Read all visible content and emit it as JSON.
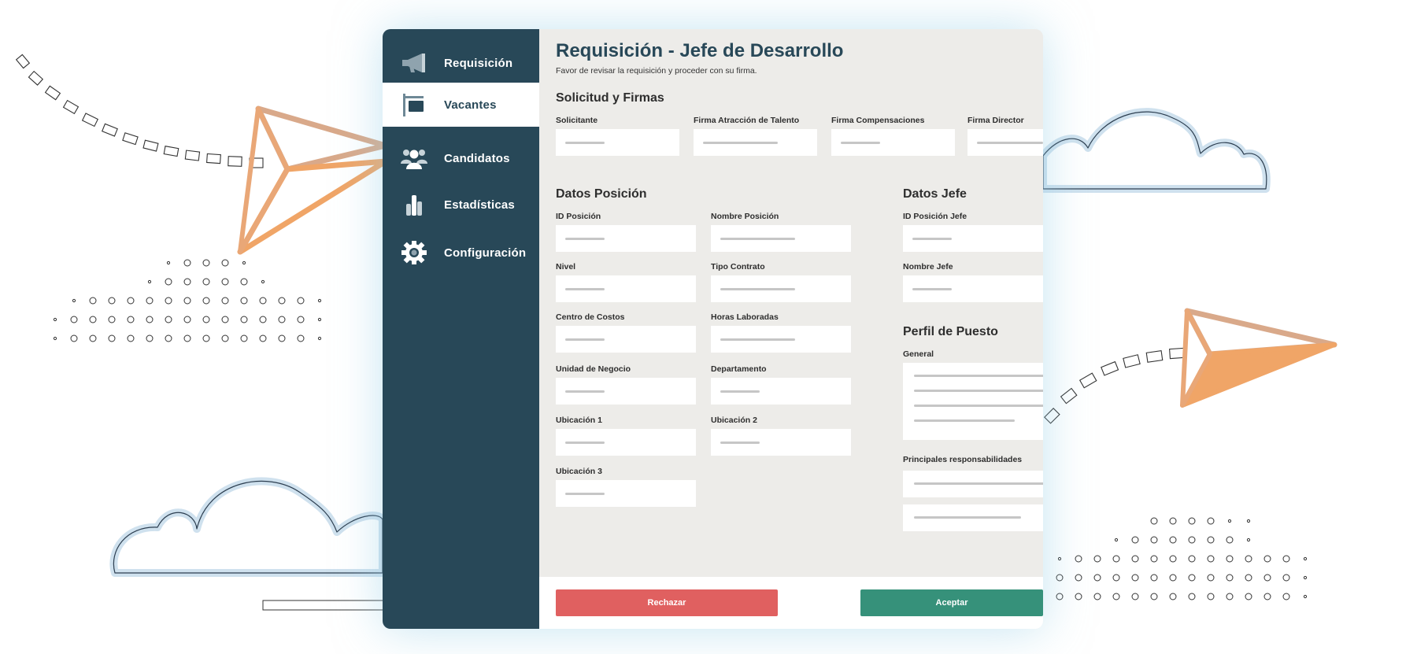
{
  "colors": {
    "sidebar": "#284858",
    "content_bg": "#edece9",
    "title": "#284858",
    "reject": "#e06060",
    "accept": "#36917a",
    "plane_orange": "#f0a567",
    "cloud_outline": "#cfe1ee"
  },
  "sidebar": {
    "items": [
      {
        "label": "Requisición",
        "icon": "megaphone-icon",
        "active": false
      },
      {
        "label": "Vacantes",
        "icon": "signpost-icon",
        "active": true
      },
      {
        "label": "Candidatos",
        "icon": "users-icon",
        "active": false
      },
      {
        "label": "Estadísticas",
        "icon": "bar-chart-icon",
        "active": false
      },
      {
        "label": "Configuración",
        "icon": "gear-icon",
        "active": false
      }
    ]
  },
  "header": {
    "title": "Requisición - Jefe de Desarrollo",
    "subtitle": "Favor de revisar la requisición y proceder con su firma."
  },
  "firmas": {
    "title": "Solicitud y Firmas",
    "fields": [
      "Solicitante",
      "Firma Atracción de Talento",
      "Firma Compensaciones",
      "Firma Director"
    ]
  },
  "posicion": {
    "title": "Datos Posición",
    "fields": [
      "ID Posición",
      "Nombre Posición",
      "Nivel",
      "Tipo Contrato",
      "Centro de Costos",
      "Horas Laboradas",
      "Unidad de Negocio",
      "Departamento",
      "Ubicación 1",
      "Ubicación 2",
      "Ubicación 3"
    ]
  },
  "jefe": {
    "title": "Datos Jefe",
    "fields": [
      "ID Posición Jefe",
      "Nombre Jefe"
    ]
  },
  "perfil": {
    "title": "Perfil de Puesto",
    "general_label": "General",
    "responsabilidades_label": "Principales responsabilidades"
  },
  "actions": {
    "reject": "Rechazar",
    "accept": "Aceptar"
  }
}
